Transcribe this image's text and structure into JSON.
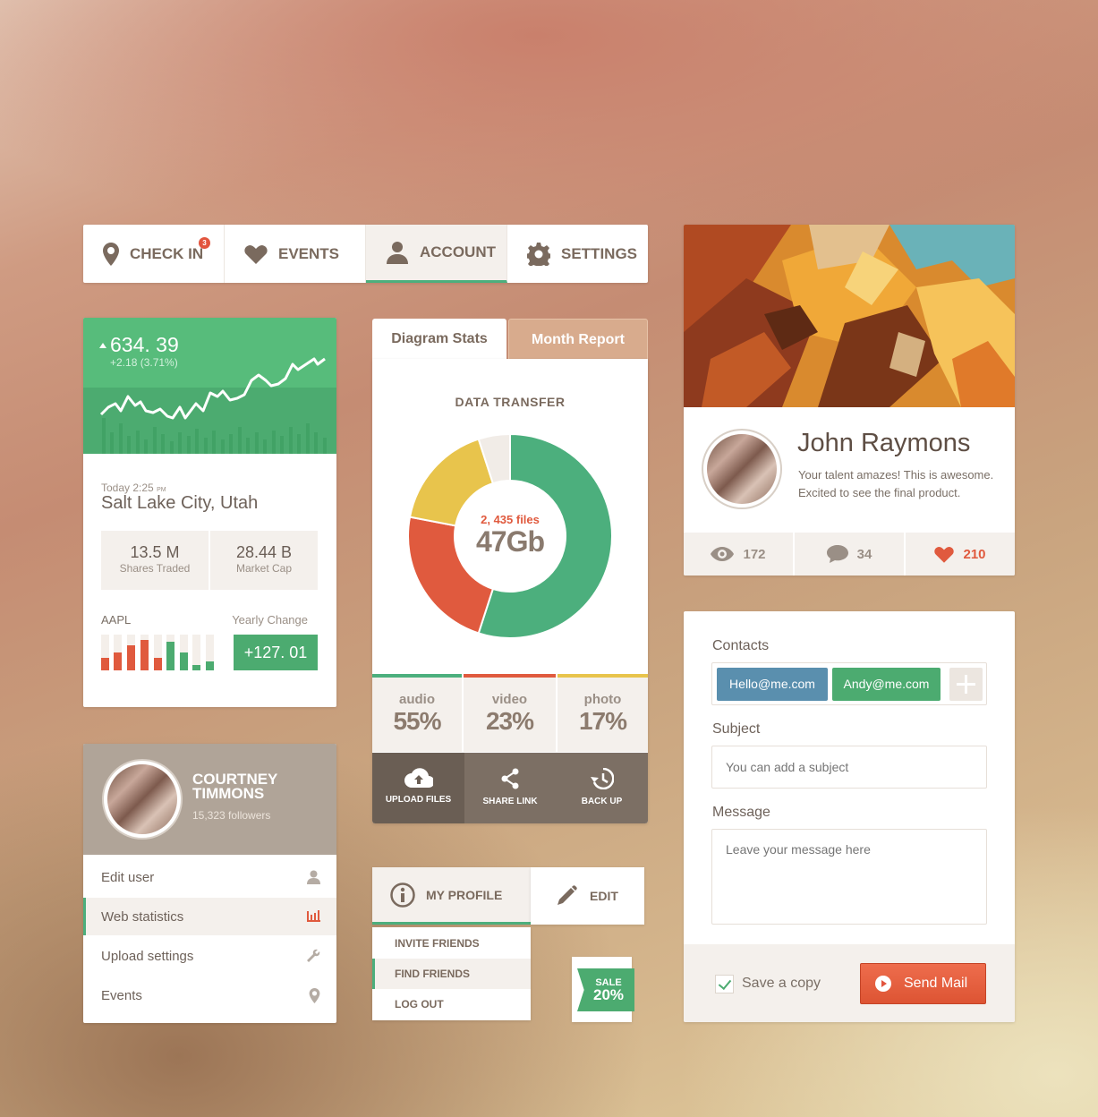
{
  "nav": {
    "items": [
      {
        "label": "CHECK IN",
        "icon": "location-pin-icon",
        "badge": "3"
      },
      {
        "label": "EVENTS",
        "icon": "heart-icon"
      },
      {
        "label": "ACCOUNT",
        "icon": "user-icon",
        "active": true
      },
      {
        "label": "SETTINGS",
        "icon": "gear-icon"
      }
    ]
  },
  "stock": {
    "price": "634. 39",
    "change": "+2.18 (3.71%)",
    "time": "Today 2:25",
    "time_suffix": "PM",
    "city": "Salt Lake City, Utah",
    "shares_value": "13.5 M",
    "shares_label": "Shares Traded",
    "cap_value": "28.44 B",
    "cap_label": "Market Cap",
    "ticker": "AAPL",
    "yearly_label": "Yearly Change",
    "yearly_value": "+127. 01"
  },
  "side_profile": {
    "name": "COURTNEY TIMMONS",
    "followers": "15,323 followers",
    "menu": [
      {
        "label": "Edit user",
        "icon": "user-icon"
      },
      {
        "label": "Web statistics",
        "icon": "bar-chart-icon",
        "active": true
      },
      {
        "label": "Upload settings",
        "icon": "wrench-icon"
      },
      {
        "label": "Events",
        "icon": "location-pin-icon"
      }
    ]
  },
  "diagram": {
    "tab_active": "Diagram Stats",
    "tab_inactive": "Month Report",
    "title": "DATA TRANSFER",
    "files": "2, 435 files",
    "size": "47Gb",
    "stats": [
      {
        "name": "audio",
        "percent": "55%",
        "color": "#4caf7d"
      },
      {
        "name": "video",
        "percent": "23%",
        "color": "#e05a3e"
      },
      {
        "name": "photo",
        "percent": "17%",
        "color": "#e8c44c"
      }
    ],
    "actions": [
      "UPLOAD FILES",
      "SHARE LINK",
      "BACK UP"
    ]
  },
  "chart_data": {
    "type": "pie",
    "categories": [
      "audio",
      "video",
      "photo"
    ],
    "values": [
      55,
      23,
      17
    ],
    "colors": [
      "#4caf7d",
      "#e05a3e",
      "#e8c44c"
    ]
  },
  "profile_menu": {
    "tab": "MY PROFILE",
    "edit": "EDIT",
    "items": [
      "INVITE FRIENDS",
      "FIND FRIENDS",
      "LOG OUT"
    ],
    "sale_label": "SALE",
    "sale_value": "20%"
  },
  "john": {
    "name": "John Raymons",
    "bio": "Your talent amazes! This is awesome. Excited to see the final product.",
    "views": "172",
    "comments": "34",
    "likes": "210"
  },
  "mail": {
    "contacts_label": "Contacts",
    "contacts": [
      "Hello@me.com",
      "Andy@me.com"
    ],
    "subject_label": "Subject",
    "subject_placeholder": "You can add a subject",
    "message_label": "Message",
    "message_placeholder": "Leave your message here",
    "save_copy": "Save a copy",
    "send": "Send Mail"
  },
  "colors": {
    "green": "#4caf7d",
    "red": "#e05a3e",
    "yellow": "#e8c44c",
    "blue": "#5a8fae",
    "taupe": "#7c6f64"
  }
}
